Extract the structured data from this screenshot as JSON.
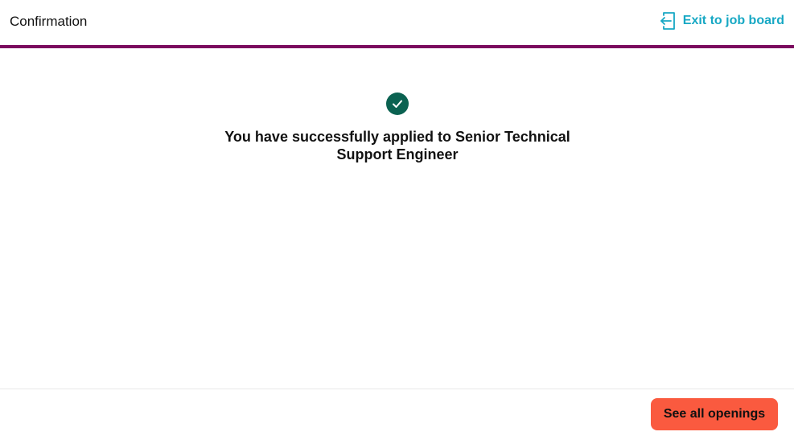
{
  "header": {
    "title": "Confirmation",
    "exit_label": "Exit to job board",
    "exit_icon": "exit-door-arrow-icon",
    "link_color": "#17a8c4",
    "rule_color": "#7b0a5e"
  },
  "main": {
    "status_icon": "checkmark-circle-icon",
    "status_color": "#0b6251",
    "message": "You have successfully applied to Senior Technical Support Engineer"
  },
  "footer": {
    "button_label": "See all openings",
    "button_color": "#fa5a3f"
  }
}
